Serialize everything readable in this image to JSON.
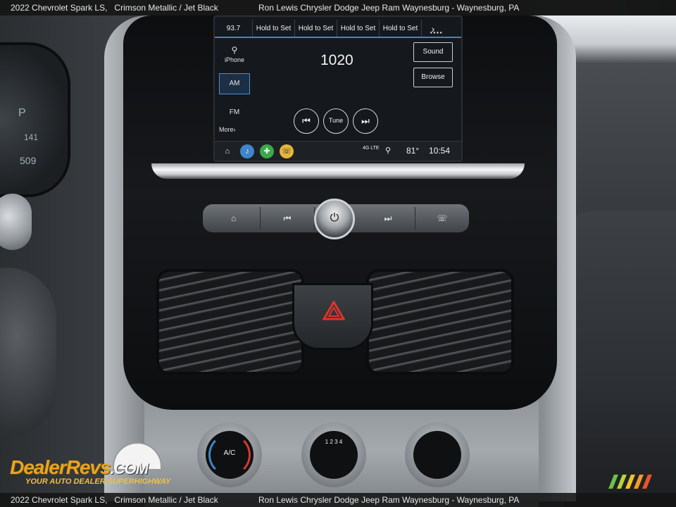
{
  "caption": {
    "vehicle": "2022 Chevrolet Spark LS,   Crimson Metallic / Jet Black",
    "dealer": "Ron Lewis Chrysler Dodge Jeep Ram Waynesburg - Waynesburg, PA"
  },
  "radio": {
    "presets": [
      "93.7",
      "Hold to Set",
      "Hold to Set",
      "Hold to Set",
      "Hold to Set"
    ],
    "current_frequency": "1020",
    "sources": [
      "iPhone",
      "AM",
      "FM",
      "More"
    ],
    "active_source": "AM",
    "buttons": {
      "sound": "Sound",
      "browse": "Browse",
      "tune": "Tune"
    },
    "status": {
      "network": "4G LTE",
      "temperature": "81°",
      "time": "10:54"
    }
  },
  "climate": {
    "ac_label": "A/C",
    "fan_levels": "1 2 3 4"
  },
  "gauge_cluster": {
    "gear": "P",
    "reading_a": "141",
    "reading_b": "509"
  },
  "watermark": {
    "brand": "DealerRevs",
    "domain": ".COM",
    "tagline": "YOUR AUTO DEALER SUPERHIGHWAY"
  },
  "icons": [
    "home-icon",
    "music-icon",
    "plus-icon",
    "phone-icon",
    "location-icon",
    "power-icon",
    "hazard-icon",
    "previous-track-icon",
    "next-track-icon"
  ],
  "colors": {
    "accent_blue": "#3f86c9",
    "hazard_red": "#e2332a",
    "watermark_orange": "#e9a51e"
  }
}
